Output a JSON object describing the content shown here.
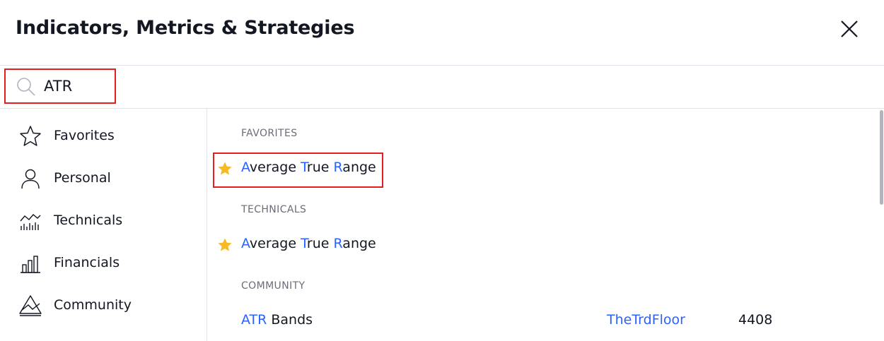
{
  "dialog": {
    "title": "Indicators, Metrics & Strategies",
    "close_icon": "close-icon"
  },
  "search": {
    "value": "ATR",
    "placeholder": "Search",
    "icon": "search-icon"
  },
  "sidebar": {
    "items": [
      {
        "label": "Favorites",
        "icon": "star-outline-icon"
      },
      {
        "label": "Personal",
        "icon": "user-icon"
      },
      {
        "label": "Technicals",
        "icon": "technicals-chart-icon"
      },
      {
        "label": "Financials",
        "icon": "bar-chart-icon"
      },
      {
        "label": "Community",
        "icon": "community-icon"
      }
    ]
  },
  "results": {
    "favorites": {
      "heading": "FAVORITES",
      "items": [
        {
          "match": [
            "A",
            "T",
            "R"
          ],
          "rest": [
            "verage ",
            "rue ",
            "ange"
          ],
          "favorite": true
        }
      ]
    },
    "technicals": {
      "heading": "TECHNICALS",
      "items": [
        {
          "match": [
            "A",
            "T",
            "R"
          ],
          "rest": [
            "verage ",
            "rue ",
            "ange"
          ],
          "favorite": true
        }
      ]
    },
    "community": {
      "heading": "COMMUNITY",
      "items": [
        {
          "match": "ATR",
          "rest": " Bands",
          "author": "TheTrdFloor",
          "count": "4408"
        }
      ]
    }
  },
  "colors": {
    "highlight": "#2962ff",
    "star": "#f7b924",
    "annotation_outline": "#e41f1f"
  }
}
